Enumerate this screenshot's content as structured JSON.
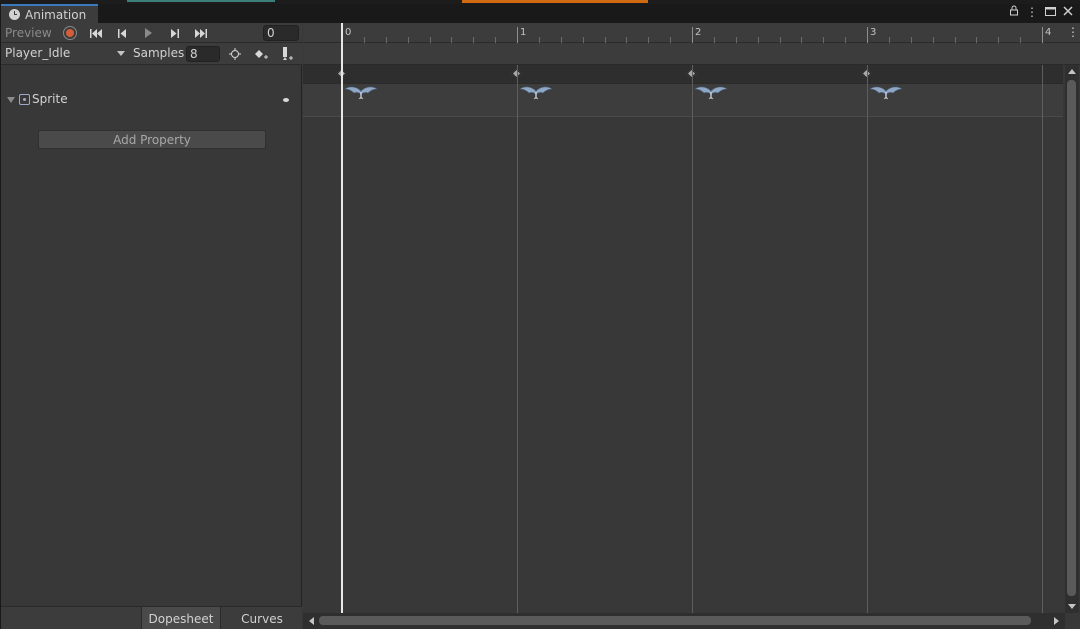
{
  "window": {
    "tab_title": "Animation",
    "lock_icon": "lock-icon",
    "more_icon": "more-icon",
    "maximize_icon": "maximize-icon",
    "close_icon": "close-icon"
  },
  "toolbar": {
    "preview_label": "Preview",
    "record_icon": "record-icon",
    "first_key_icon": "first-keyframe-icon",
    "prev_key_icon": "previous-keyframe-icon",
    "play_icon": "play-icon",
    "next_key_icon": "next-keyframe-icon",
    "last_key_icon": "last-keyframe-icon",
    "current_frame": "0"
  },
  "clip": {
    "selected": "Player_Idle",
    "samples_label": "Samples",
    "samples_value": "8"
  },
  "properties": [
    {
      "label": "Sprite",
      "icon": "sprite-icon"
    }
  ],
  "add_property_label": "Add Property",
  "modes": {
    "dopesheet": "Dopesheet",
    "curves": "Curves"
  },
  "timeline": {
    "ruler_labels": [
      "0",
      "1",
      "2",
      "3",
      "4"
    ],
    "keyframes": [
      0,
      1,
      2,
      3
    ],
    "current_time": 0
  },
  "colors": {
    "accent_blue": "#3a79bb",
    "record_red": "#d45d3b",
    "panel_bg": "#383838"
  }
}
